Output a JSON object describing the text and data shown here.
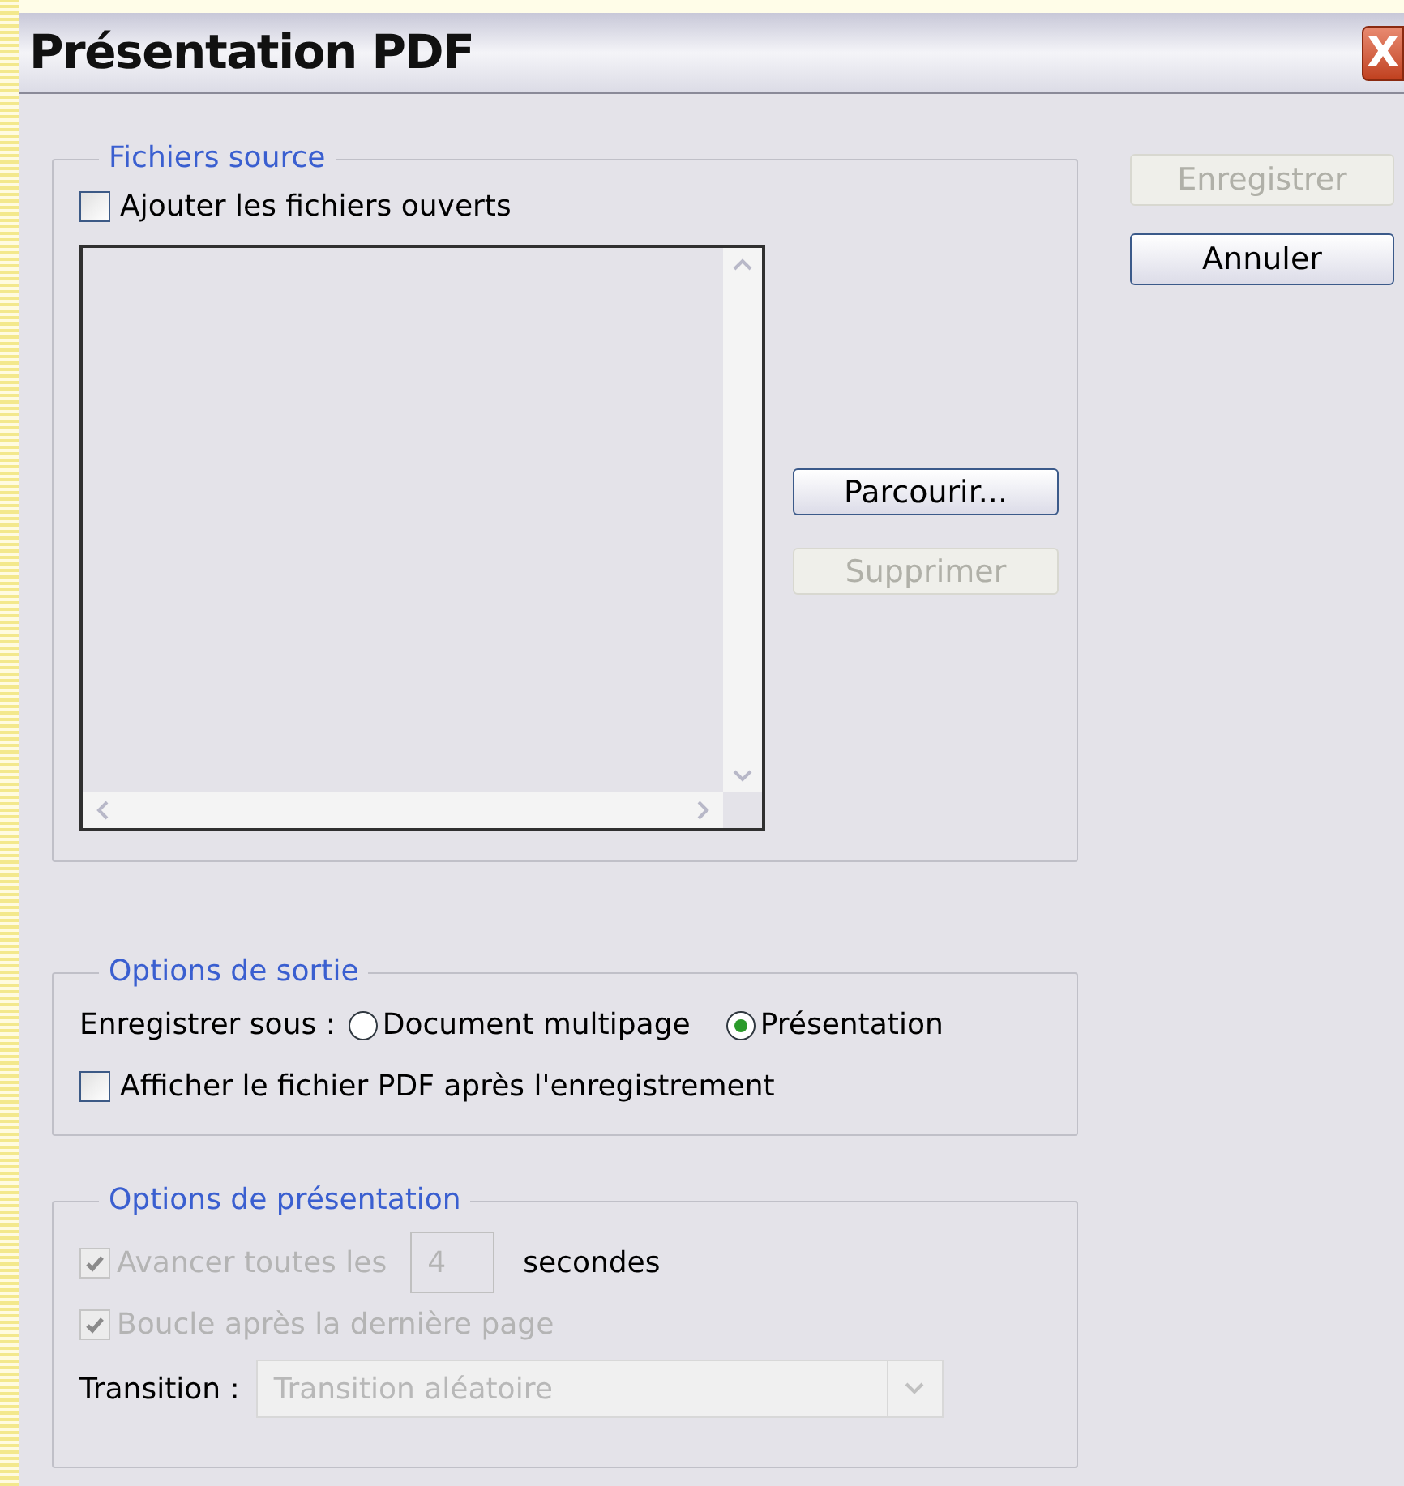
{
  "window": {
    "title": "Présentation PDF",
    "close": "X"
  },
  "side_buttons": [
    {
      "label": "Enregistrer",
      "disabled": true
    },
    {
      "label": "Annuler",
      "disabled": false
    }
  ],
  "source_files": {
    "title": "Fichiers source",
    "add_open": {
      "label": "Ajouter les fichiers ouverts",
      "checked": false
    },
    "buttons": [
      {
        "label": "Parcourir...",
        "disabled": false
      },
      {
        "label": "Supprimer",
        "disabled": true
      }
    ]
  },
  "output_options": {
    "title": "Options de sortie",
    "save_as_label": "Enregistrer sous :",
    "formats": [
      {
        "label": "Document multipage",
        "selected": false
      },
      {
        "label": "Présentation",
        "selected": true
      }
    ],
    "show_pdf": {
      "label": "Afficher le fichier PDF après l'enregistrement",
      "checked": false
    }
  },
  "presentation_options": {
    "title": "Options de présentation",
    "disabled": true,
    "advance": {
      "label": "Avancer toutes les",
      "checked": true,
      "value": "4",
      "unit": "secondes"
    },
    "loop": {
      "label": "Boucle après la dernière page",
      "checked": true
    },
    "transition": {
      "label": "Transition :",
      "value": "Transition aléatoire"
    }
  }
}
